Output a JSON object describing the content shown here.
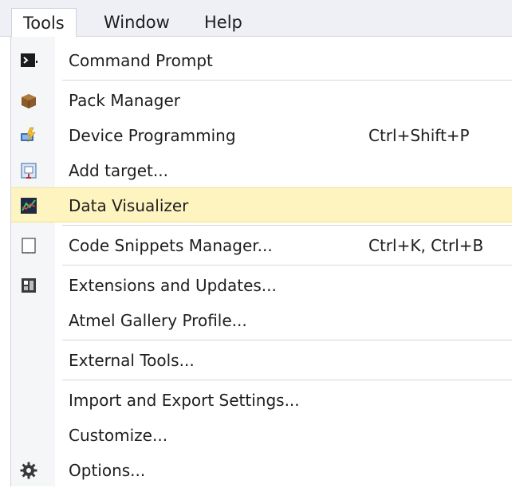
{
  "menubar": {
    "items": [
      {
        "label": "Tools"
      },
      {
        "label": "Window"
      },
      {
        "label": "Help"
      }
    ]
  },
  "menu": {
    "items": [
      {
        "label": "Command Prompt",
        "shortcut": "",
        "icon": "command-prompt-icon"
      },
      {
        "label": "Pack Manager",
        "shortcut": "",
        "icon": "package-icon"
      },
      {
        "label": "Device Programming",
        "shortcut": "Ctrl+Shift+P",
        "icon": "device-programming-icon"
      },
      {
        "label": "Add target...",
        "shortcut": "",
        "icon": "add-target-icon"
      },
      {
        "label": "Data Visualizer",
        "shortcut": "",
        "icon": "data-visualizer-icon"
      },
      {
        "label": "Code Snippets Manager...",
        "shortcut": "Ctrl+K, Ctrl+B",
        "icon": "code-snippets-icon"
      },
      {
        "label": "Extensions and Updates...",
        "shortcut": "",
        "icon": "extensions-icon"
      },
      {
        "label": "Atmel Gallery Profile...",
        "shortcut": ""
      },
      {
        "label": "External Tools...",
        "shortcut": ""
      },
      {
        "label": "Import and Export Settings...",
        "shortcut": ""
      },
      {
        "label": "Customize...",
        "shortcut": ""
      },
      {
        "label": "Options...",
        "shortcut": "",
        "icon": "gear-icon"
      }
    ],
    "highlighted_item": "Data Visualizer"
  },
  "colors": {
    "highlight": "#fdf4bf",
    "menubar": "#eef0f5"
  }
}
